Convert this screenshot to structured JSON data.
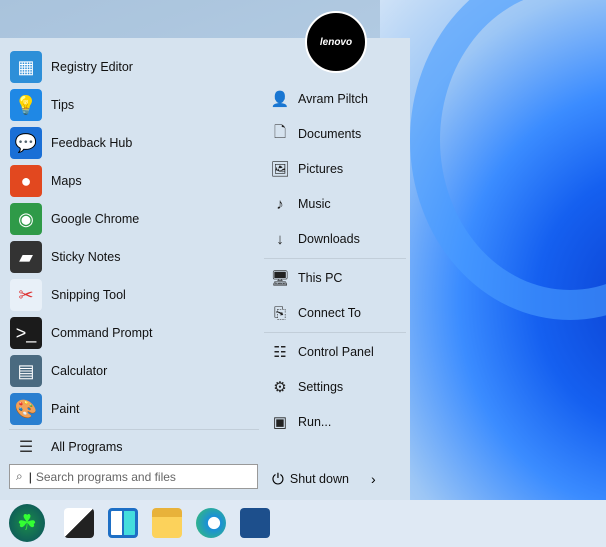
{
  "left_items": [
    {
      "label": "Registry Editor",
      "icon": "registry-icon",
      "color": "#2d8fd8"
    },
    {
      "label": "Tips",
      "icon": "lightbulb-icon",
      "color": "#1f88e5"
    },
    {
      "label": "Feedback Hub",
      "icon": "feedback-icon",
      "color": "#1a6fd6"
    },
    {
      "label": "Maps",
      "icon": "map-pin-icon",
      "color": "#e2481f"
    },
    {
      "label": "Google Chrome",
      "icon": "chrome-icon",
      "color": "#2f9a48"
    },
    {
      "label": "Sticky Notes",
      "icon": "sticky-note-icon",
      "color": "#333333"
    },
    {
      "label": "Snipping Tool",
      "icon": "scissors-icon",
      "color": "#e8f0f8"
    },
    {
      "label": "Command Prompt",
      "icon": "terminal-icon",
      "color": "#1b1b1b"
    },
    {
      "label": "Calculator",
      "icon": "calculator-icon",
      "color": "#4a6a80"
    },
    {
      "label": "Paint",
      "icon": "palette-icon",
      "color": "#2a7fd0"
    }
  ],
  "all_programs": "All Programs",
  "search": {
    "placeholder": "Search programs and files"
  },
  "user": {
    "name": "Avram Piltch",
    "avatar_text": "lenovo"
  },
  "right_items": [
    {
      "label": "Documents",
      "icon": "document-icon"
    },
    {
      "label": "Pictures",
      "icon": "picture-icon"
    },
    {
      "label": "Music",
      "icon": "music-note-icon"
    },
    {
      "label": "Downloads",
      "icon": "download-icon"
    },
    {
      "label": "This PC",
      "icon": "computer-icon"
    },
    {
      "label": "Connect To",
      "icon": "connect-icon"
    },
    {
      "label": "Control Panel",
      "icon": "control-panel-icon"
    },
    {
      "label": "Settings",
      "icon": "gear-icon"
    },
    {
      "label": "Run...",
      "icon": "run-icon"
    }
  ],
  "shutdown": "Shut down"
}
